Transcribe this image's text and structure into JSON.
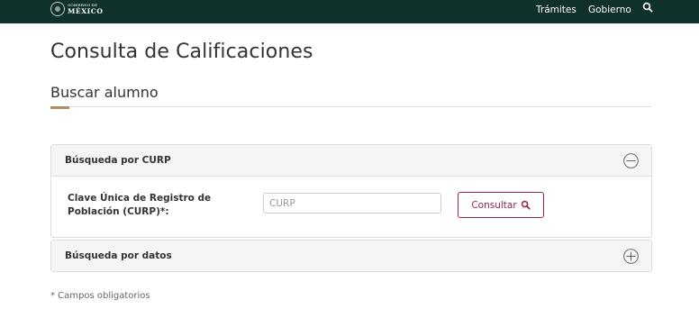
{
  "nav": {
    "logo_small": "GOBIERNO DE",
    "logo_big": "MÉXICO",
    "links": [
      "Trámites",
      "Gobierno"
    ],
    "search_icon": "search-icon"
  },
  "page": {
    "title": "Consulta de Calificaciones",
    "section_title": "Buscar alumno"
  },
  "panels": [
    {
      "title": "Búsqueda por CURP",
      "expanded": true,
      "toggle_icon": "minus-circle-icon",
      "field_label": "Clave Única de Registro de Población (CURP)*:",
      "input_placeholder": "CURP",
      "input_value": "",
      "button_label": "Consultar",
      "button_icon": "search-icon"
    },
    {
      "title": "Búsqueda por datos",
      "expanded": false,
      "toggle_icon": "plus-circle-icon"
    }
  ],
  "footnote": "* Campos obligatorios",
  "colors": {
    "navbar": "#10312b",
    "accent_gold": "#b38e5d",
    "button_wine": "#9d2449"
  }
}
